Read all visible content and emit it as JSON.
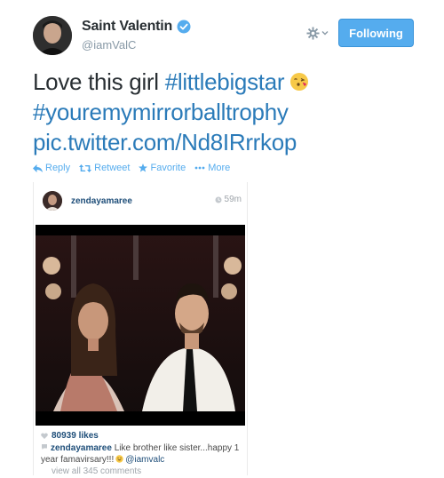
{
  "author": {
    "display_name": "Saint Valentin",
    "handle": "@iamValC",
    "verified": true
  },
  "follow_button": {
    "label": "Following"
  },
  "settings_menu": {
    "icon": "gear-icon"
  },
  "tweet": {
    "text_prefix": "Love this girl ",
    "hashtag_1": "#littlebigstar",
    "emoji": "face-throwing-kiss",
    "hashtag_2": "#youremymirrorballtrophy",
    "link": "pic.twitter.com/Nd8IRrrkop"
  },
  "actions": {
    "reply": "Reply",
    "retweet": "Retweet",
    "favorite": "Favorite",
    "more": "More"
  },
  "instagram_card": {
    "username": "zendayamaree",
    "time": "59m",
    "likes": "80939 likes",
    "comment_user": "zendayamaree",
    "comment_text": "Like brother like sister...happy 1 year famavirsary!!!",
    "comment_mention": "@iamvalc",
    "view_all": "view all 345 comments"
  },
  "colors": {
    "link_blue": "#2b7bb9",
    "follow_blue": "#55acee",
    "instagram_blue": "#1e4e79"
  }
}
